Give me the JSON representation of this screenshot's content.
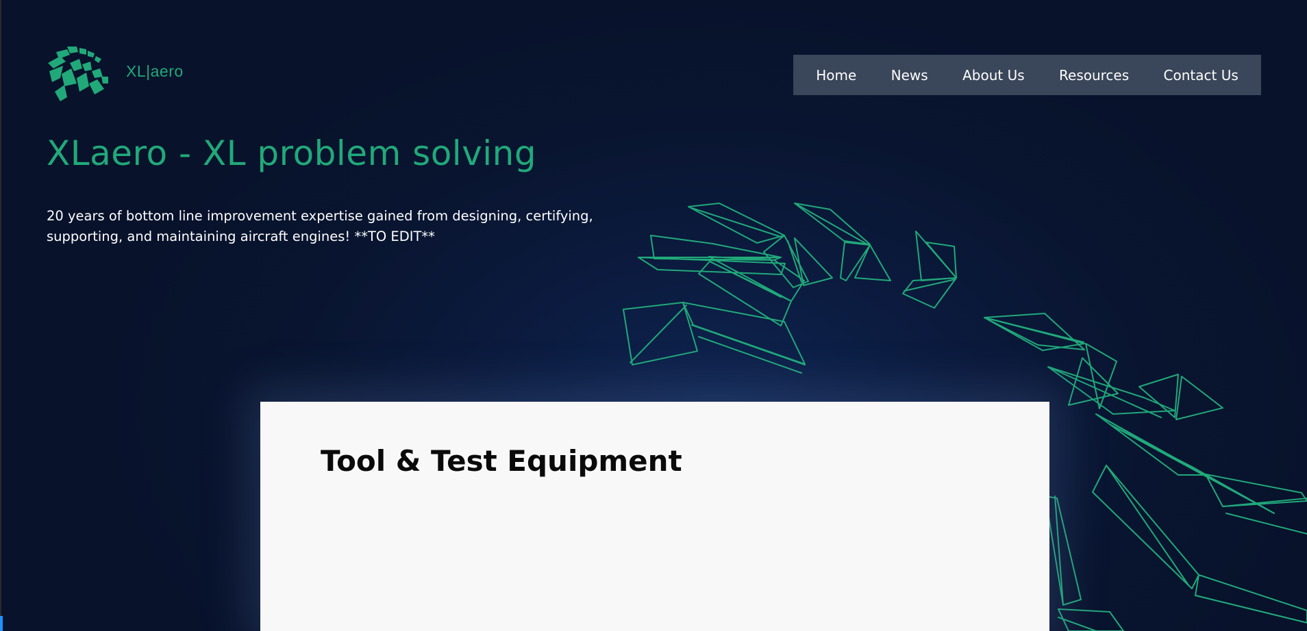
{
  "site": {
    "logo_text": "XL|aero",
    "logo_icon": "turbine-blades-icon"
  },
  "nav": {
    "items": [
      {
        "label": "Home"
      },
      {
        "label": "News"
      },
      {
        "label": "About Us"
      },
      {
        "label": "Resources"
      },
      {
        "label": "Contact Us"
      }
    ]
  },
  "hero": {
    "title": "XLaero - XL problem solving",
    "description": "20 years of bottom line improvement expertise gained from designing, certifying, supporting, and maintaining aircraft engines! **TO EDIT**"
  },
  "card": {
    "title": "Tool & Test Equipment"
  },
  "colors": {
    "accent": "#21a97a",
    "background": "#0b1530",
    "nav_background": "#3a4659",
    "card_background": "#f8f8f8"
  }
}
